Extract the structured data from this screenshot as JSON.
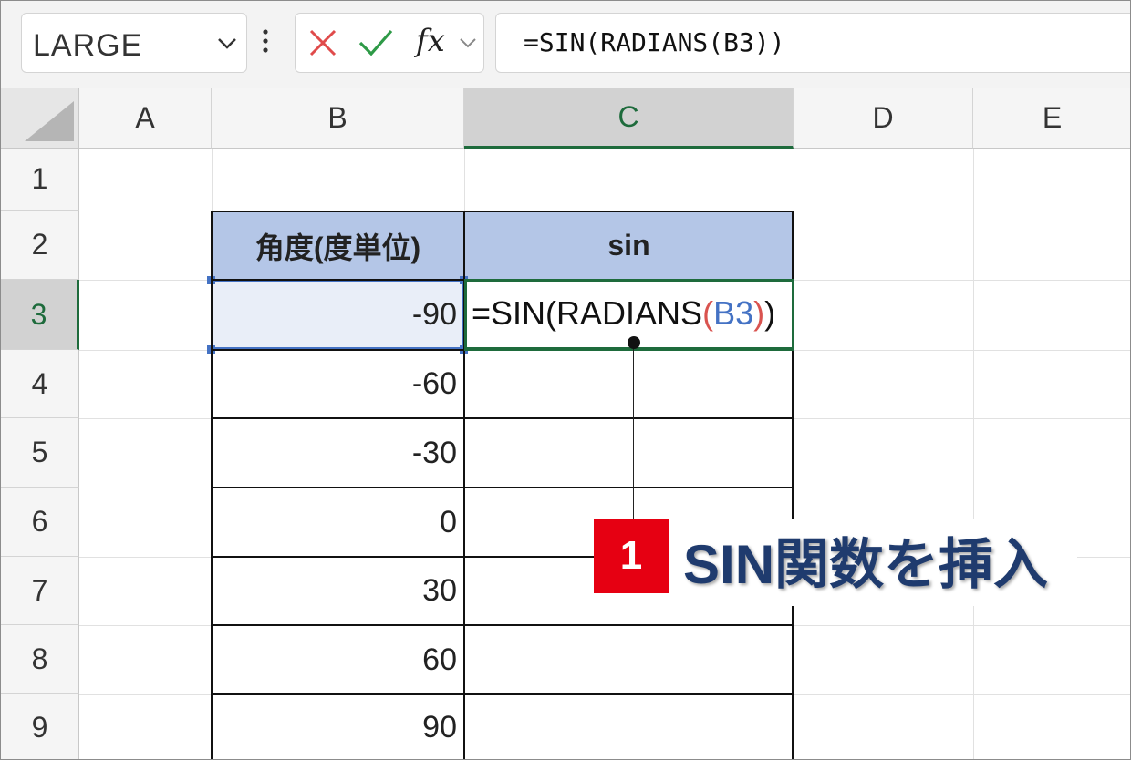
{
  "formula_bar": {
    "name_box": "LARGE",
    "fx_label": "fx",
    "formula": "=SIN(RADIANS(B3))"
  },
  "columns": [
    "A",
    "B",
    "C",
    "D",
    "E"
  ],
  "rows": [
    "1",
    "2",
    "3",
    "4",
    "5",
    "6",
    "7",
    "8",
    "9"
  ],
  "table": {
    "header_b": "角度(度単位)",
    "header_c": "sin",
    "b_values": [
      "-90",
      "-60",
      "-30",
      "0",
      "30",
      "60",
      "90"
    ]
  },
  "editing_cell": {
    "prefix": "=SIN(RADIANS",
    "paren_open": "(",
    "ref": "B3",
    "paren_close": ")",
    "suffix": ")"
  },
  "annotation": {
    "step": "1",
    "text": "SIN関数を挿入"
  },
  "colors": {
    "header_fill": "#b4c6e7",
    "select_blue": "#4472c4",
    "edit_green": "#1e6b3c",
    "badge_red": "#e60012",
    "callout_text": "#1f3b6e"
  }
}
